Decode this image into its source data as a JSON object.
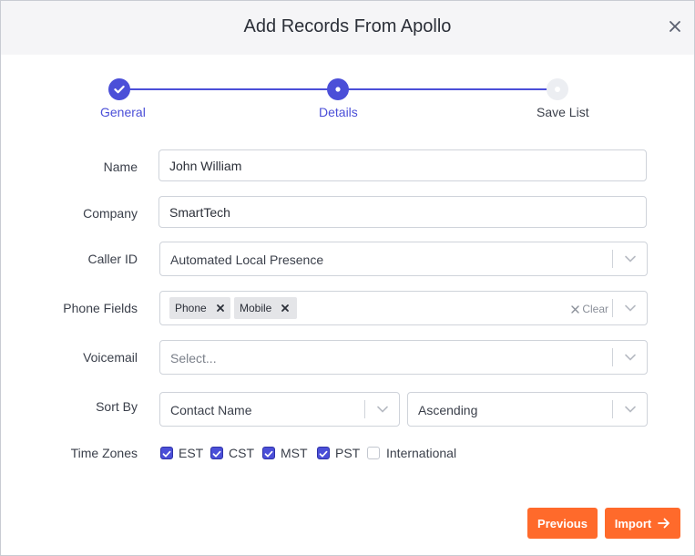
{
  "dialog": {
    "title": "Add Records From Apollo"
  },
  "stepper": {
    "steps": [
      {
        "label": "General",
        "state": "completed"
      },
      {
        "label": "Details",
        "state": "current"
      },
      {
        "label": "Save List",
        "state": "upcoming"
      }
    ]
  },
  "form": {
    "name": {
      "label": "Name",
      "value": "John William"
    },
    "company": {
      "label": "Company",
      "value": "SmartTech"
    },
    "caller_id": {
      "label": "Caller ID",
      "value": "Automated Local Presence"
    },
    "phone_fields": {
      "label": "Phone Fields",
      "tags": [
        "Phone",
        "Mobile"
      ],
      "clear_label": "Clear"
    },
    "voicemail": {
      "label": "Voicemail",
      "placeholder": "Select..."
    },
    "sort_by": {
      "label": "Sort By",
      "field": "Contact Name",
      "order": "Ascending"
    },
    "time_zones": {
      "label": "Time Zones",
      "options": [
        {
          "label": "EST",
          "checked": true
        },
        {
          "label": "CST",
          "checked": true
        },
        {
          "label": "MST",
          "checked": true
        },
        {
          "label": "PST",
          "checked": true
        },
        {
          "label": "International",
          "checked": false
        }
      ]
    }
  },
  "footer": {
    "previous_label": "Previous",
    "import_label": "Import"
  },
  "colors": {
    "accent": "#4b4fd8",
    "button": "#ff6a2b",
    "header_bg": "#f5f5f7"
  }
}
